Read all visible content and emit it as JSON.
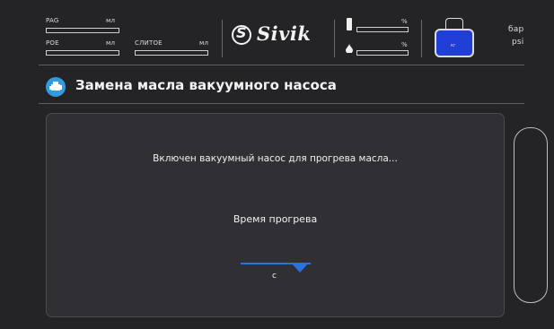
{
  "status": {
    "pag_label": "PAG",
    "pag_unit": "мл",
    "poe_label": "POE",
    "poe_unit": "мл",
    "drain_label": "СЛИТОЕ",
    "drain_unit": "мл",
    "temp_unit": "%",
    "humidity_unit": "%",
    "pressure_unit_bar": "бар",
    "pressure_unit_psi": "psi",
    "tank_unit": "кг"
  },
  "logo": {
    "text": "Sivik",
    "mark": "S"
  },
  "header": {
    "title": "Замена масла вакуумного насоса",
    "icon": "engine-icon"
  },
  "panel": {
    "message": "Включен вакуумный насос для прогрева масла...",
    "time_label": "Время прогрева",
    "time_value": "",
    "time_unit": "с"
  },
  "colors": {
    "accent": "#2d72d8",
    "tank_fill": "#1f3fd6",
    "icon_bg": "#2f9be0"
  }
}
